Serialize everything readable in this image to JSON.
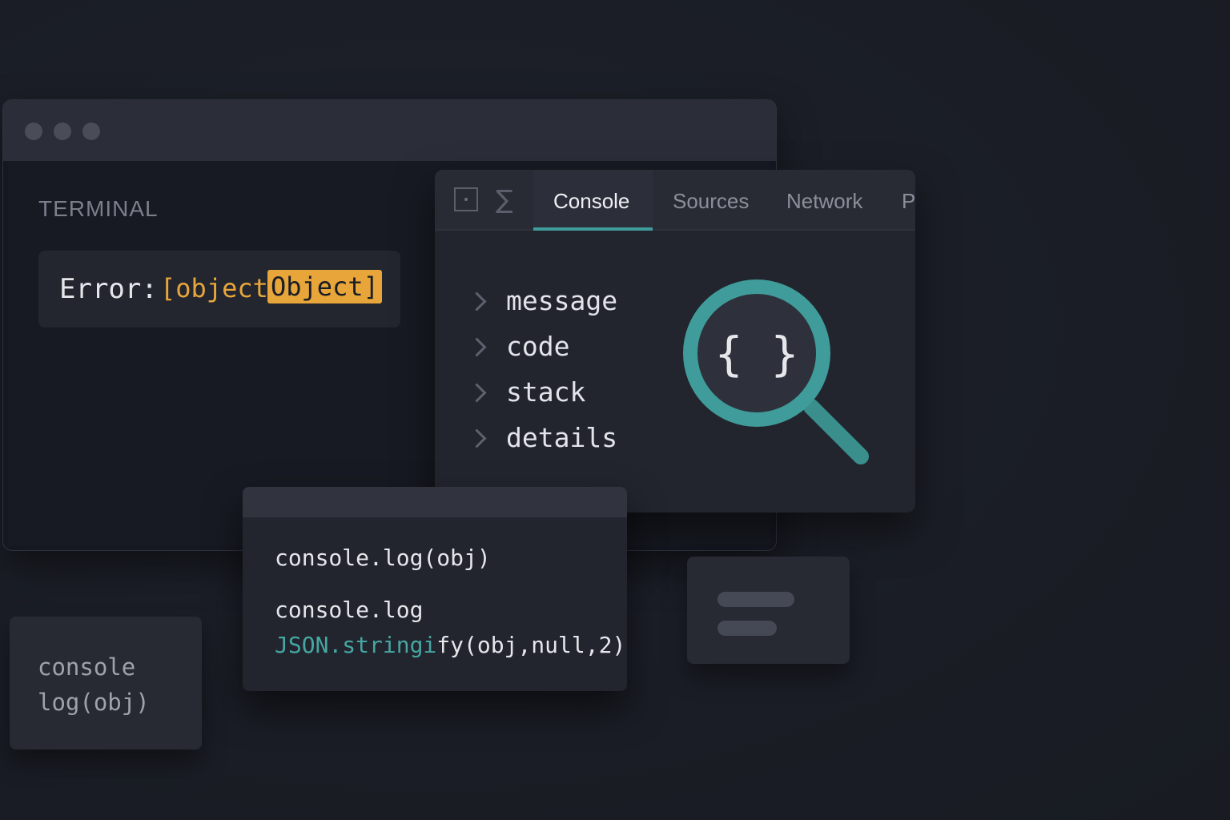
{
  "terminal": {
    "heading": "TERMINAL",
    "error_label": "Error:",
    "error_value": "[object",
    "error_value_highlight": "Object]"
  },
  "devtools": {
    "tabs": [
      {
        "label": "Console",
        "active": true
      },
      {
        "label": "Sources",
        "active": false
      },
      {
        "label": "Network",
        "active": false
      },
      {
        "label": "Pe",
        "active": false
      }
    ],
    "properties": [
      "message",
      "code",
      "stack",
      "details"
    ],
    "magnifier_glyph": "{ }"
  },
  "code_card": {
    "line1": "console.log(obj)",
    "line2": "console.log",
    "line3_teal": "JSON.stringi",
    "line3_rest": "fy(obj,null,2)"
  },
  "small_card": {
    "line1": "console",
    "line2": "log(obj)"
  },
  "colors": {
    "accent_teal": "#3f9c9a",
    "highlight_orange": "#e8a53a",
    "background": "#1a1d25"
  }
}
